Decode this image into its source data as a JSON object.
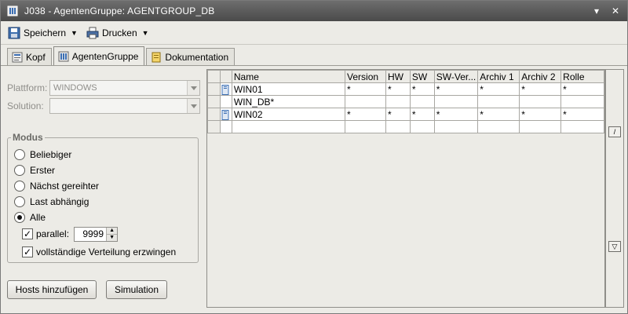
{
  "window": {
    "title": "J038 - AgentenGruppe: AGENTGROUP_DB",
    "minimize_glyph": "▾",
    "close_glyph": "✕"
  },
  "toolbar": {
    "save_label": "Speichern",
    "print_label": "Drucken"
  },
  "tabs": [
    {
      "label": "Kopf",
      "active": false
    },
    {
      "label": "AgentenGruppe",
      "active": true
    },
    {
      "label": "Dokumentation",
      "active": false
    }
  ],
  "form": {
    "platform": {
      "label": "Plattform:",
      "value": "WINDOWS"
    },
    "solution": {
      "label": "Solution:",
      "value": ""
    }
  },
  "modus": {
    "title": "Modus",
    "options": [
      {
        "label": "Beliebiger",
        "selected": false
      },
      {
        "label": "Erster",
        "selected": false
      },
      {
        "label": "Nächst gereihter",
        "selected": false
      },
      {
        "label": "Last abhängig",
        "selected": false
      },
      {
        "label": "Alle",
        "selected": true
      }
    ],
    "parallel": {
      "label": "parallel:",
      "checked": true,
      "value": "9999"
    },
    "force_distribution": {
      "label": "vollständige Verteilung erzwingen",
      "checked": true
    }
  },
  "buttons": {
    "add_hosts": "Hosts hinzufügen",
    "simulation": "Simulation"
  },
  "table": {
    "columns": [
      "Name",
      "Version",
      "HW",
      "SW",
      "SW-Ver...",
      "Archiv 1",
      "Archiv 2",
      "Rolle"
    ],
    "rows": [
      {
        "icon": true,
        "cells": [
          "WIN01",
          "*",
          "*",
          "*",
          "*",
          "*",
          "*",
          "*"
        ]
      },
      {
        "icon": false,
        "cells": [
          "WIN_DB*",
          "",
          "",
          "",
          "",
          "",
          "",
          ""
        ]
      },
      {
        "icon": true,
        "cells": [
          "WIN02",
          "*",
          "*",
          "*",
          "*",
          "*",
          "*",
          "*"
        ]
      },
      {
        "icon": false,
        "cells": [
          "",
          "",
          "",
          "",
          "",
          "",
          "",
          ""
        ]
      }
    ]
  },
  "scrollbar": {
    "top_glyph": "/",
    "bottom_glyph": "▽"
  },
  "colors": {
    "titlebar": "#555555",
    "background": "#ecebe6",
    "icon_blue": "#3c6fb4"
  }
}
